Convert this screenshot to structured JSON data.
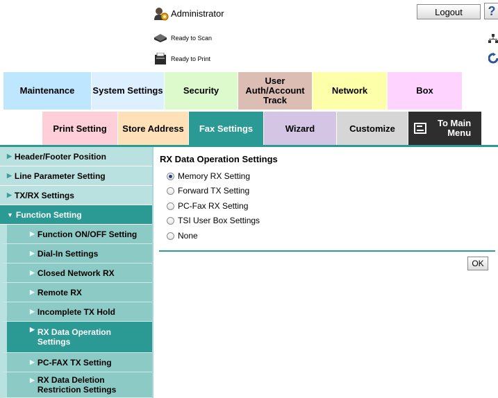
{
  "header": {
    "user_label": "Administrator",
    "logout_label": "Logout",
    "help_glyph": "?",
    "status": {
      "scan": "Ready to Scan",
      "print": "Ready to Print"
    }
  },
  "top_tabs": [
    {
      "label": "Maintenance",
      "color": "#bfe6ff"
    },
    {
      "label": "System Settings",
      "color": "#ddf0ff"
    },
    {
      "label": "Security",
      "color": "#ddfacc"
    },
    {
      "label": "User\nAuth/Account\nTrack",
      "color": "#dcbdb4"
    },
    {
      "label": "Network",
      "color": "#feffa9"
    },
    {
      "label": "Box",
      "color": "#ffd3ff"
    }
  ],
  "sub_tabs": [
    {
      "label": "Print Setting",
      "color": "#ffcfd9"
    },
    {
      "label": "Store Address",
      "color": "#ffe1b8"
    },
    {
      "label": "Fax Settings",
      "color": "#2b9a94",
      "active": true
    },
    {
      "label": "Wizard",
      "color": "#d5c5e5"
    },
    {
      "label": "Customize",
      "color": "#d6d6d6"
    },
    {
      "label": "To Main\nMenu",
      "color": "#2e2e2e"
    }
  ],
  "sidebar": {
    "items": [
      {
        "label": "Header/Footer Position",
        "level": 1
      },
      {
        "label": "Line Parameter Setting",
        "level": 1
      },
      {
        "label": "TX/RX Settings",
        "level": 1
      },
      {
        "label": "Function Setting",
        "level": 1,
        "expanded": true
      },
      {
        "label": "Function ON/OFF Setting",
        "level": 2
      },
      {
        "label": "Dial-In Settings",
        "level": 2
      },
      {
        "label": "Closed Network RX",
        "level": 2
      },
      {
        "label": "Remote RX",
        "level": 2
      },
      {
        "label": "Incomplete TX Hold",
        "level": 2
      },
      {
        "label": "RX Data Operation\nSettings",
        "level": 2,
        "selected": true
      },
      {
        "label": "PC-FAX TX Setting",
        "level": 2
      },
      {
        "label": "RX Data Deletion\nRestriction Settings",
        "level": 2
      }
    ]
  },
  "content": {
    "title": "RX Data Operation Settings",
    "options": [
      {
        "label": "Memory RX Setting",
        "selected": true
      },
      {
        "label": "Forward TX Setting",
        "selected": false
      },
      {
        "label": "PC-Fax RX Setting",
        "selected": false
      },
      {
        "label": "TSI User Box Settings",
        "selected": false
      },
      {
        "label": "None",
        "selected": false
      }
    ],
    "ok_label": "OK"
  }
}
